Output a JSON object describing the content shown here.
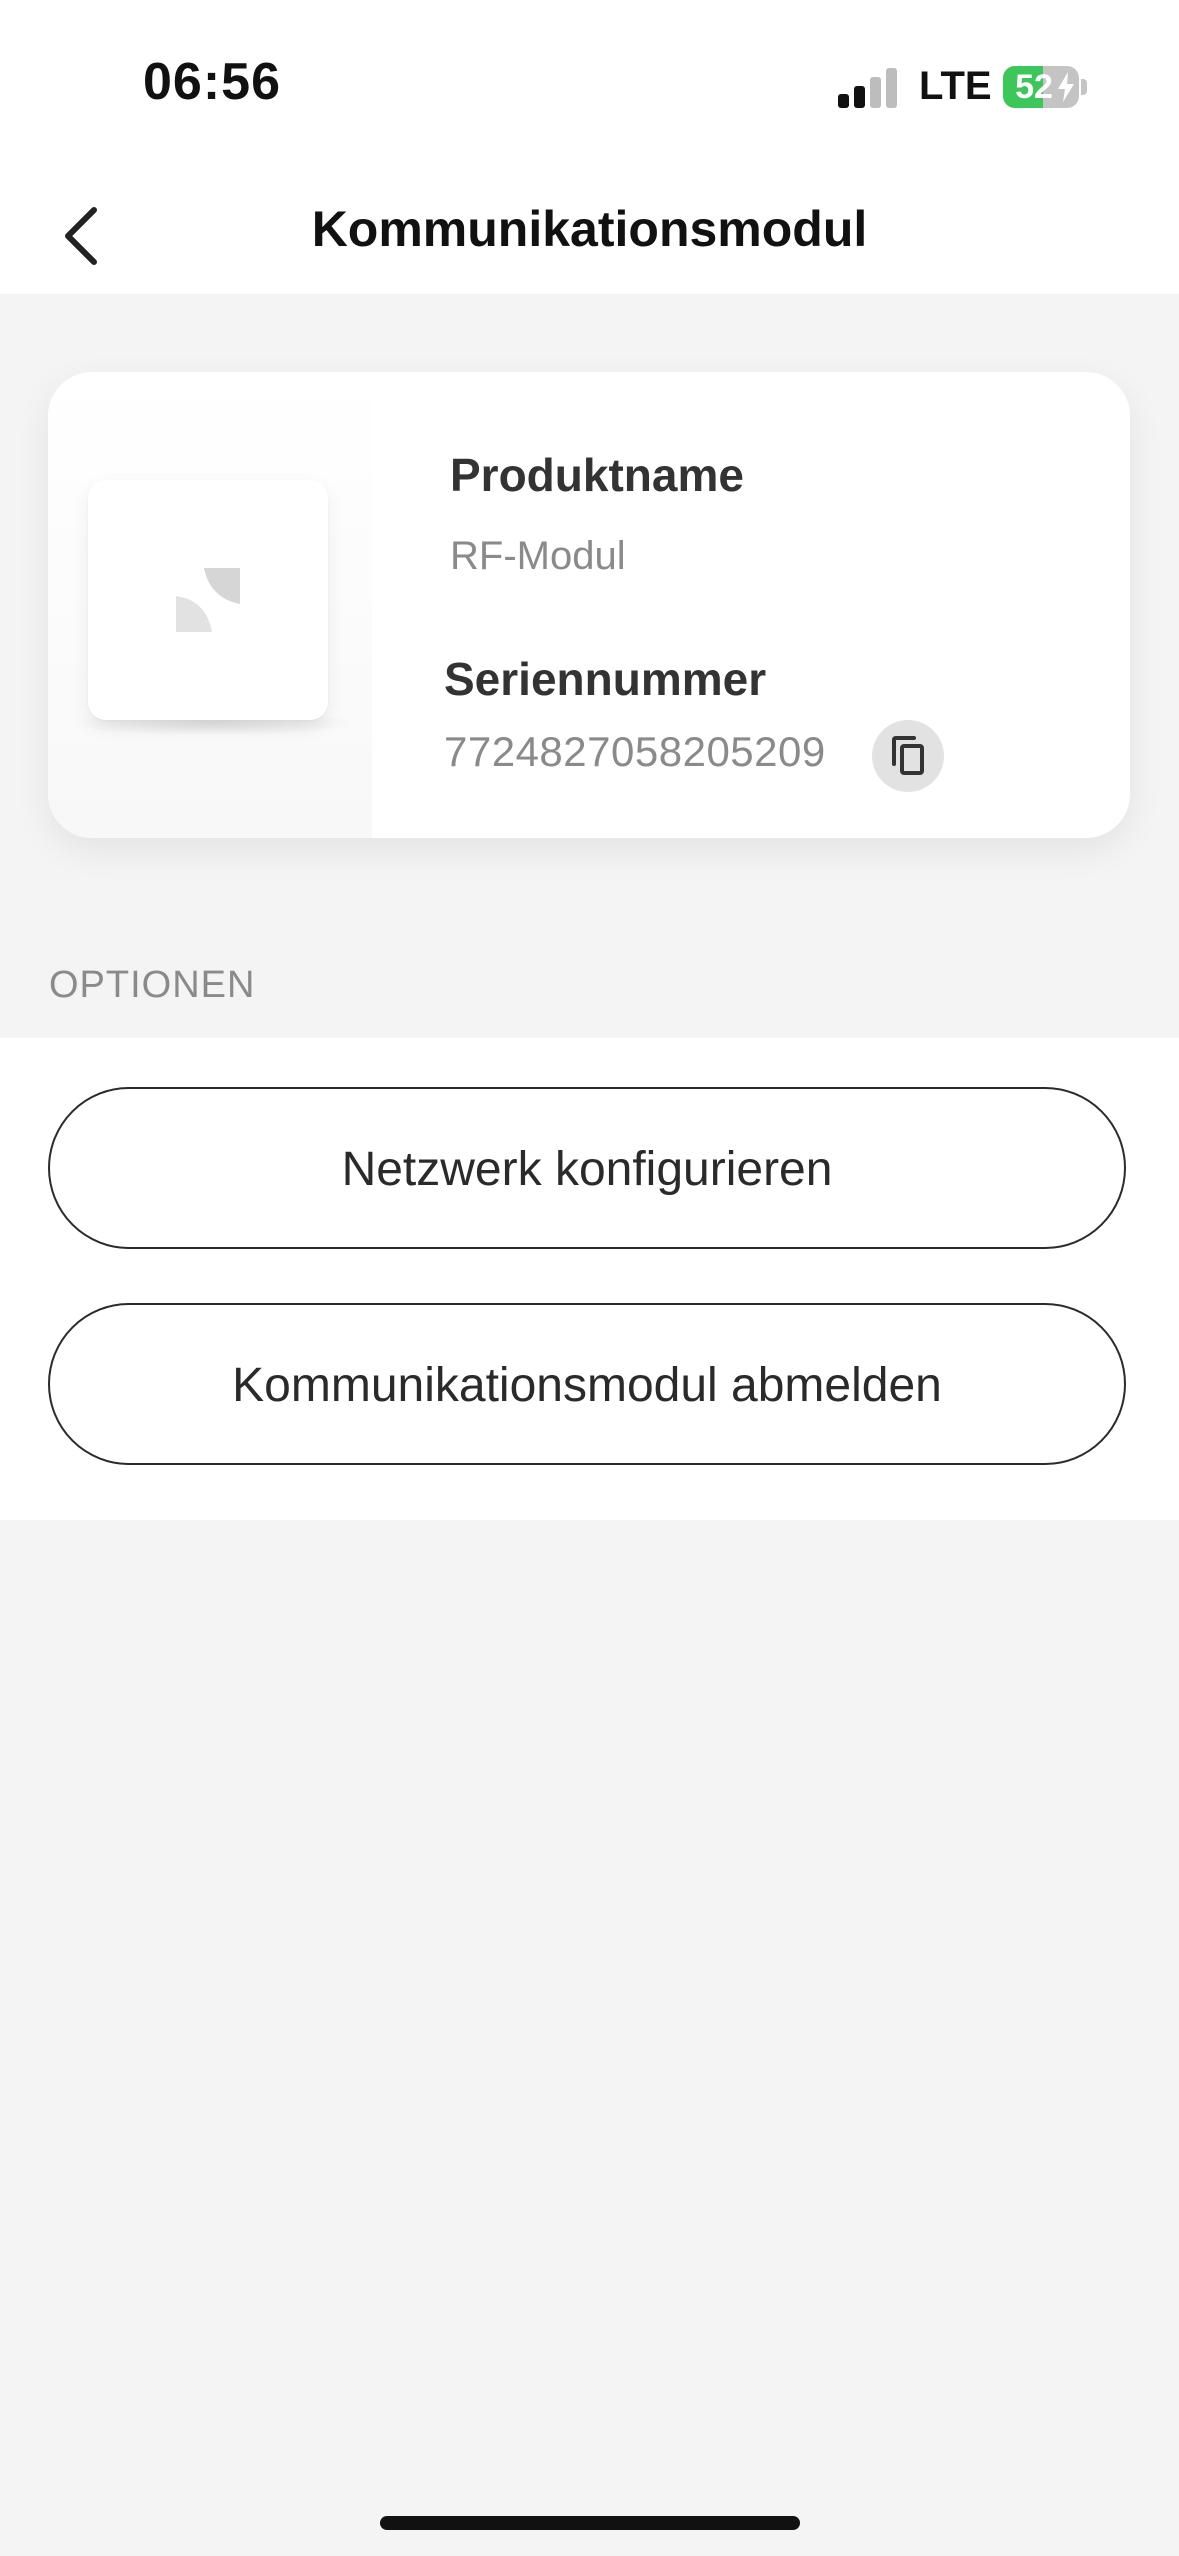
{
  "status_bar": {
    "time": "06:56",
    "network": "LTE",
    "battery_percent": "52",
    "battery_level": 0.52,
    "battery_color": "#3dc65a",
    "signal_bars_active": 2,
    "signal_bars_total": 4
  },
  "nav": {
    "title": "Kommunikationsmodul",
    "back_icon": "chevron-left-icon"
  },
  "device_card": {
    "product_label": "Produktname",
    "product_value": "RF-Modul",
    "serial_label": "Seriennummer",
    "serial_value": "7724827058205209",
    "copy_icon": "copy-icon",
    "thumbnail_icon": "device-logo-icon"
  },
  "options": {
    "header": "OPTIONEN",
    "buttons": [
      {
        "label": "Netzwerk konfigurieren"
      },
      {
        "label": "Kommunikationsmodul abmelden"
      }
    ]
  }
}
